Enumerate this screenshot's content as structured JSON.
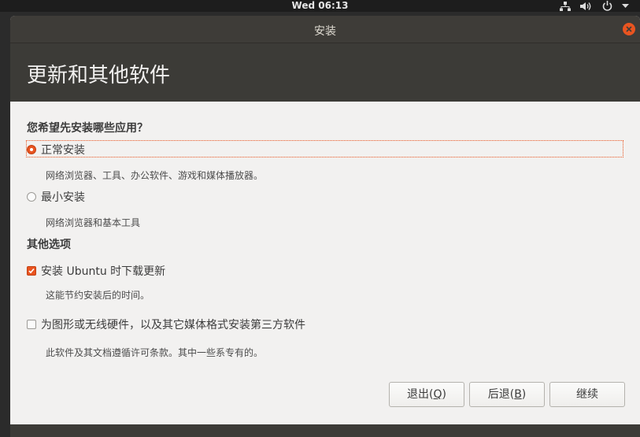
{
  "panel": {
    "clock": "Wed 06:13",
    "icons": [
      "network-icon",
      "volume-icon",
      "power-icon",
      "menu-arrow-icon"
    ]
  },
  "window": {
    "title": "安装",
    "close_icon": "close-icon"
  },
  "header": {
    "title": "更新和其他软件"
  },
  "install_type": {
    "heading": "您希望先安装哪些应用？",
    "options": [
      {
        "label": "正常安装",
        "desc": "网络浏览器、工具、办公软件、游戏和媒体播放器。",
        "selected": true
      },
      {
        "label": "最小安装",
        "desc": "网络浏览器和基本工具",
        "selected": false
      }
    ]
  },
  "other_options": {
    "heading": "其他选项",
    "items": [
      {
        "label": "安装 Ubuntu 时下载更新",
        "desc": "这能节约安装后的时间。",
        "checked": true
      },
      {
        "label": "为图形或无线硬件，以及其它媒体格式安装第三方软件",
        "desc": "此软件及其文档遵循许可条款。其中一些系专有的。",
        "checked": false
      }
    ]
  },
  "buttons": {
    "quit": {
      "label": "退出",
      "mnemonic": "Q"
    },
    "back": {
      "label": "后退",
      "mnemonic": "B"
    },
    "continue": {
      "label": "继续"
    }
  },
  "colors": {
    "accent": "#e95420",
    "header_bg": "#3c3b37",
    "titlebar_bg": "#3e3c38",
    "content_bg": "#f2f1f0"
  }
}
